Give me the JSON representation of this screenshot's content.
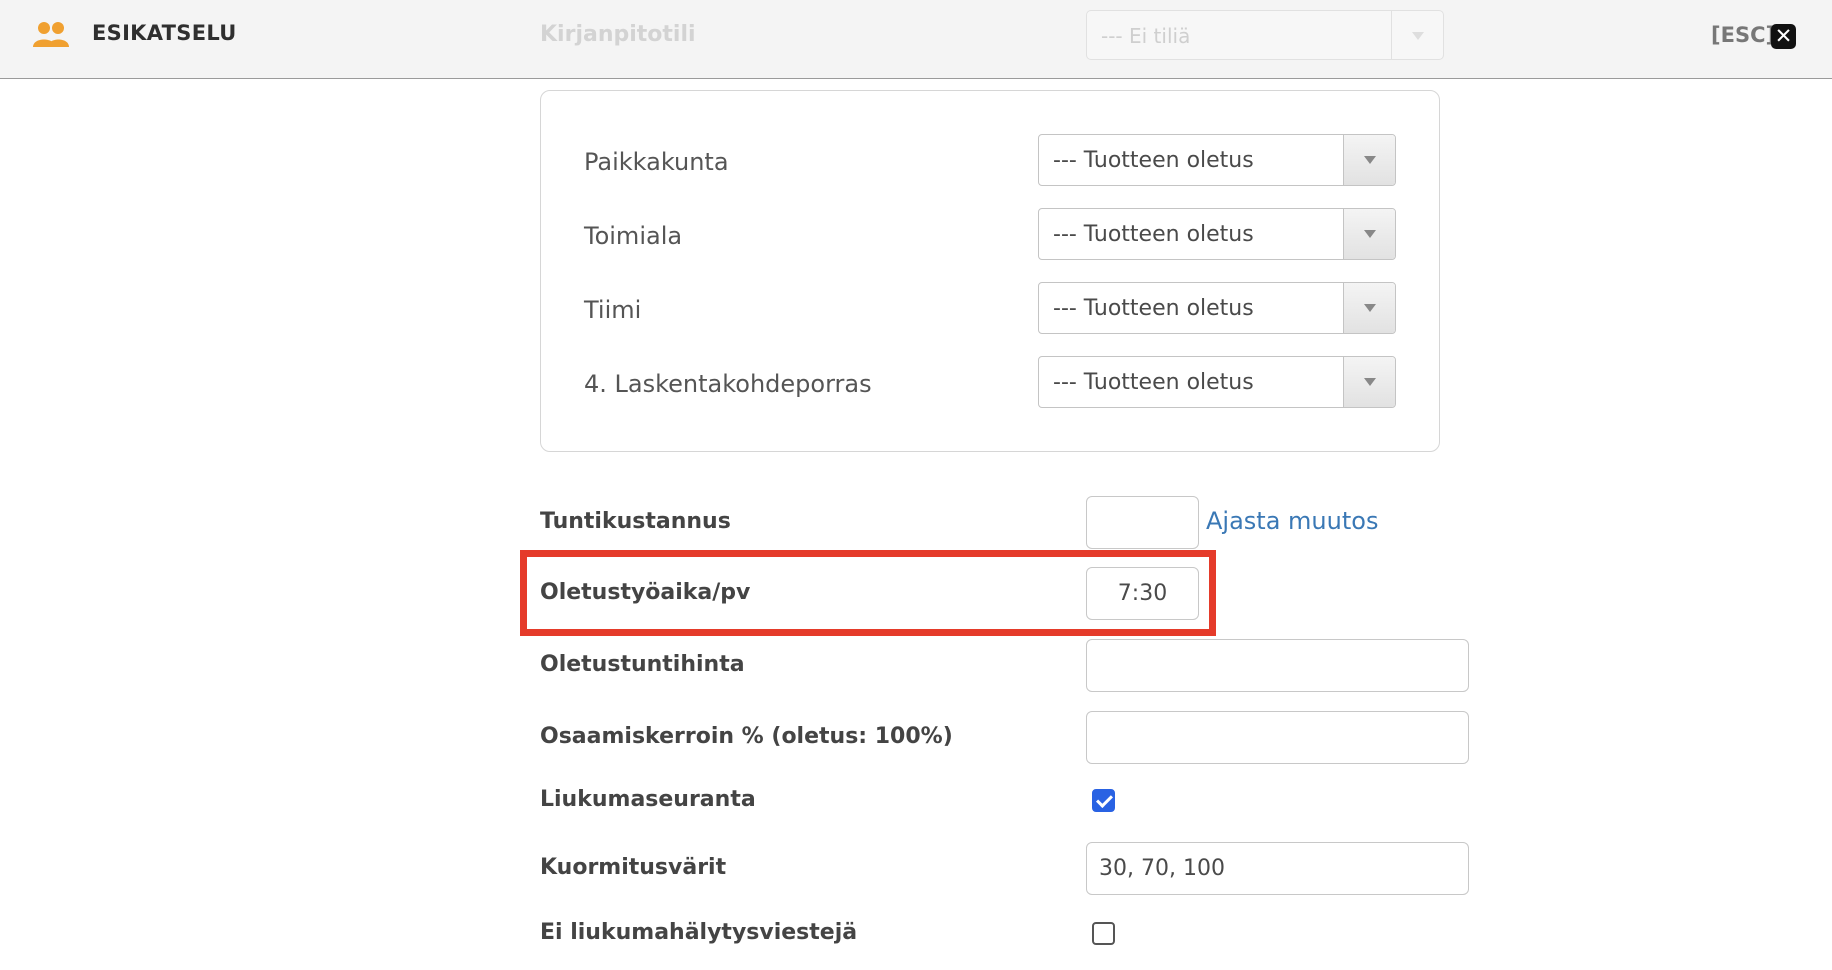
{
  "header": {
    "title": "ESIKATSELU",
    "ghost_field_label": "Kirjanpitotili",
    "ghost_select_value": "--- Ei tiliä",
    "esc_label": "[ESC]",
    "close_glyph": "✕",
    "brand_icon": "users-icon",
    "brand_color": "#f0a030"
  },
  "dimensions": [
    {
      "label": "Paikkakunta",
      "value": "--- Tuotteen oletus"
    },
    {
      "label": "Toimiala",
      "value": "--- Tuotteen oletus"
    },
    {
      "label": "Tiimi",
      "value": "--- Tuotteen oletus"
    },
    {
      "label": "4. Laskentakohdeporras",
      "value": "--- Tuotteen oletus"
    }
  ],
  "form": {
    "tuntikustannus": {
      "label": "Tuntikustannus",
      "value": "",
      "link": "Ajasta muutos"
    },
    "oletustyoaika": {
      "label": "Oletustyöaika/pv",
      "value": "7:30"
    },
    "oletustuntihinta": {
      "label": "Oletustuntihinta",
      "value": ""
    },
    "osaamiskerroin": {
      "label": "Osaamiskerroin % (oletus: 100%)",
      "value": ""
    },
    "liukumaseuranta": {
      "label": "Liukumaseuranta",
      "checked": true
    },
    "kuormitusvarit": {
      "label": "Kuormitusvärit",
      "value": "30, 70, 100"
    },
    "ei_liukumahalytys": {
      "label": "Ei liukumahälytysviestejä",
      "checked": false
    }
  },
  "colors": {
    "highlight": "#e53b2a",
    "link": "#3a78b5",
    "checkbox_checked": "#2962e3"
  }
}
